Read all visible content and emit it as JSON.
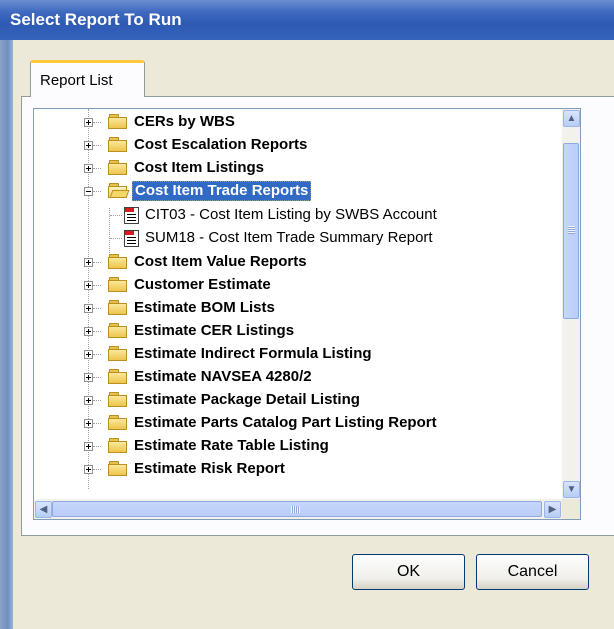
{
  "window": {
    "title": "Select Report To Run"
  },
  "tabs": [
    {
      "label": "Report List",
      "active": true
    }
  ],
  "tree": {
    "items": [
      {
        "label": "CERs by WBS",
        "type": "folder",
        "expanded": false
      },
      {
        "label": "Cost Escalation Reports",
        "type": "folder",
        "expanded": false
      },
      {
        "label": "Cost Item Listings",
        "type": "folder",
        "expanded": false
      },
      {
        "label": "Cost Item Trade Reports",
        "type": "folder",
        "expanded": true,
        "selected": true
      },
      {
        "label": "CIT03 - Cost Item Listing by SWBS Account",
        "type": "report"
      },
      {
        "label": "SUM18 - Cost Item Trade Summary Report",
        "type": "report"
      },
      {
        "label": "Cost Item Value Reports",
        "type": "folder",
        "expanded": false
      },
      {
        "label": "Customer Estimate",
        "type": "folder",
        "expanded": false
      },
      {
        "label": "Estimate BOM Lists",
        "type": "folder",
        "expanded": false
      },
      {
        "label": "Estimate CER Listings",
        "type": "folder",
        "expanded": false
      },
      {
        "label": "Estimate Indirect Formula Listing",
        "type": "folder",
        "expanded": false
      },
      {
        "label": "Estimate NAVSEA 4280/2",
        "type": "folder",
        "expanded": false
      },
      {
        "label": "Estimate Package Detail Listing",
        "type": "folder",
        "expanded": false
      },
      {
        "label": "Estimate Parts Catalog Part Listing Report",
        "type": "folder",
        "expanded": false
      },
      {
        "label": "Estimate Rate Table Listing",
        "type": "folder",
        "expanded": false
      },
      {
        "label": "Estimate Risk Report",
        "type": "folder",
        "expanded": false
      }
    ]
  },
  "buttons": {
    "ok": "OK",
    "cancel": "Cancel"
  },
  "colors": {
    "titlebar": "#2e5ab4",
    "selection": "#316ac5",
    "dialog_bg": "#ece9d8"
  }
}
